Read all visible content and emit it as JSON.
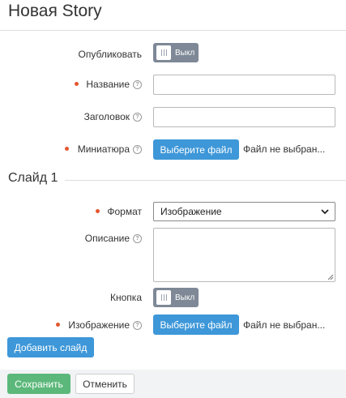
{
  "page": {
    "title": "Новая Story"
  },
  "form": {
    "publish": {
      "label": "Опубликовать",
      "toggle_text": "Выкл"
    },
    "name": {
      "label": "Название",
      "value": ""
    },
    "heading": {
      "label": "Заголовок",
      "value": ""
    },
    "thumbnail": {
      "label": "Миниатюра",
      "button": "Выберите файл",
      "status": "Файл не выбран..."
    }
  },
  "slide": {
    "title": "Слайд 1",
    "format": {
      "label": "Формат",
      "selected": "Изображение"
    },
    "description": {
      "label": "Описание",
      "value": ""
    },
    "button": {
      "label": "Кнопка",
      "toggle_text": "Выкл"
    },
    "image": {
      "label": "Изображение",
      "button": "Выберите файл",
      "status": "Файл не выбран..."
    }
  },
  "add_slide_label": "Добавить слайд",
  "footer": {
    "save_label": "Сохранить",
    "cancel_label": "Отменить"
  },
  "colors": {
    "primary": "#3d97d8",
    "success": "#5cb87a",
    "required": "#e4572e",
    "toggle_off": "#7e8896"
  }
}
